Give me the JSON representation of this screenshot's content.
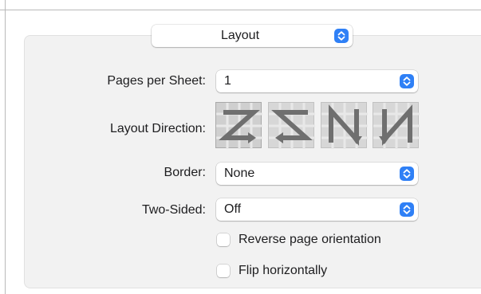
{
  "section_popup": {
    "value": "Layout"
  },
  "pages_per_sheet": {
    "label": "Pages per Sheet:",
    "value": "1"
  },
  "layout_direction": {
    "label": "Layout Direction:",
    "options": [
      {
        "icon": "z-left-right-icon",
        "selected": true
      },
      {
        "icon": "reverse-z-icon",
        "selected": false
      },
      {
        "icon": "n-down-icon",
        "selected": false
      },
      {
        "icon": "reverse-n-icon",
        "selected": false
      }
    ]
  },
  "border": {
    "label": "Border:",
    "value": "None"
  },
  "two_sided": {
    "label": "Two-Sided:",
    "value": "Off"
  },
  "checkboxes": {
    "reverse_orientation": {
      "label": "Reverse page orientation",
      "checked": false
    },
    "flip_horizontally": {
      "label": "Flip horizontally",
      "checked": false
    }
  },
  "colors": {
    "accent": "#2f80f6",
    "panel": "#f2f2f2"
  }
}
